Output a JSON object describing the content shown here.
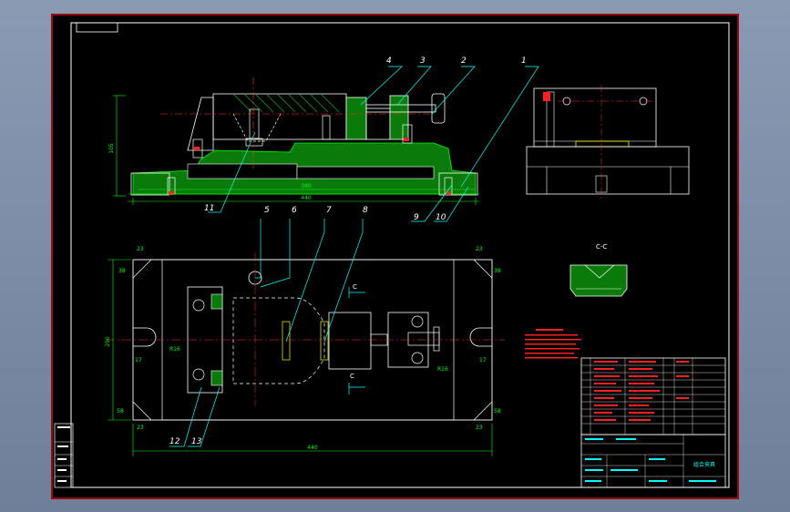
{
  "balloons": {
    "b1": "1",
    "b2": "2",
    "b3": "3",
    "b4": "4",
    "b5": "5",
    "b6": "6",
    "b7": "7",
    "b8": "8",
    "b9": "9",
    "b10": "10",
    "b11": "11",
    "b12": "12",
    "b13": "13"
  },
  "dimensions": {
    "front_width_inner": "380",
    "front_width_outer": "440",
    "front_height": "105",
    "plan_width": "440",
    "plan_height": "250",
    "corner_23": "23",
    "corner_38": "38",
    "corner_17": "17",
    "corner_58": "58",
    "r16": "R16",
    "r15": "R16"
  },
  "section_labels": {
    "c_top": "C",
    "c_bottom": "C",
    "cc_view": "C-C"
  },
  "title_block": {
    "sheet_name": "组合夹具"
  },
  "colors": {
    "frame": "#ff1010",
    "outline": "#ffffff",
    "dimension": "#00ff00",
    "leader": "#00ffff",
    "hatch": "#00c000",
    "center": "#ff3030",
    "note": "#ff2020"
  }
}
